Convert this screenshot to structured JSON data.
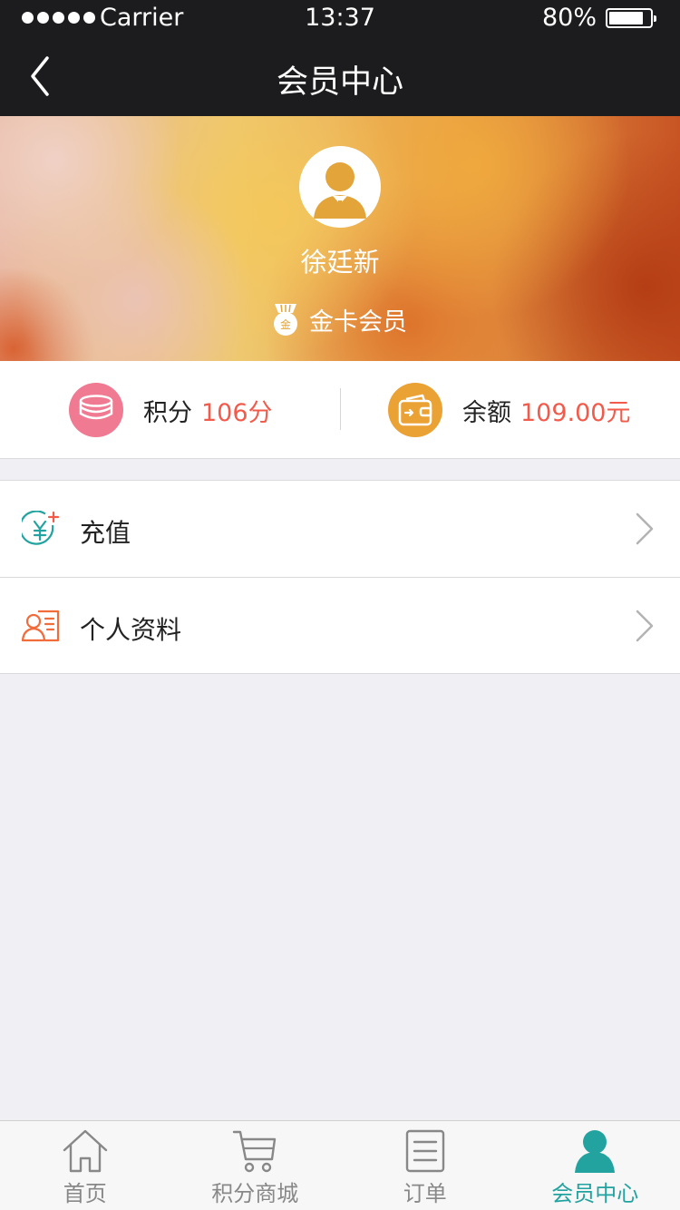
{
  "status_bar": {
    "carrier": "Carrier",
    "time": "13:37",
    "battery": "80%",
    "battery_level": 0.8
  },
  "nav": {
    "title": "会员中心",
    "back_icon": "chevron-left-icon"
  },
  "profile": {
    "name": "徐廷新",
    "level_badge_text": "金",
    "level_label": "金卡会员"
  },
  "stats": {
    "points": {
      "label": "积分",
      "value": "106分",
      "icon": "coins-icon",
      "color": "#ef7a92"
    },
    "balance": {
      "label": "余额",
      "value": "109.00元",
      "icon": "wallet-icon",
      "color": "#eaa235"
    }
  },
  "menu": {
    "items": [
      {
        "label": "充值",
        "icon": "yuan-plus-icon"
      },
      {
        "label": "个人资料",
        "icon": "profile-card-icon"
      }
    ]
  },
  "tabbar": {
    "tabs": [
      {
        "label": "首页",
        "icon": "home-icon",
        "active": false
      },
      {
        "label": "积分商城",
        "icon": "cart-icon",
        "active": false
      },
      {
        "label": "订单",
        "icon": "list-icon",
        "active": false
      },
      {
        "label": "会员中心",
        "icon": "user-icon",
        "active": true
      }
    ]
  },
  "colors": {
    "accent": "#23a3a0",
    "highlight": "#f25b4b",
    "topbar": "#1c1c1e"
  }
}
